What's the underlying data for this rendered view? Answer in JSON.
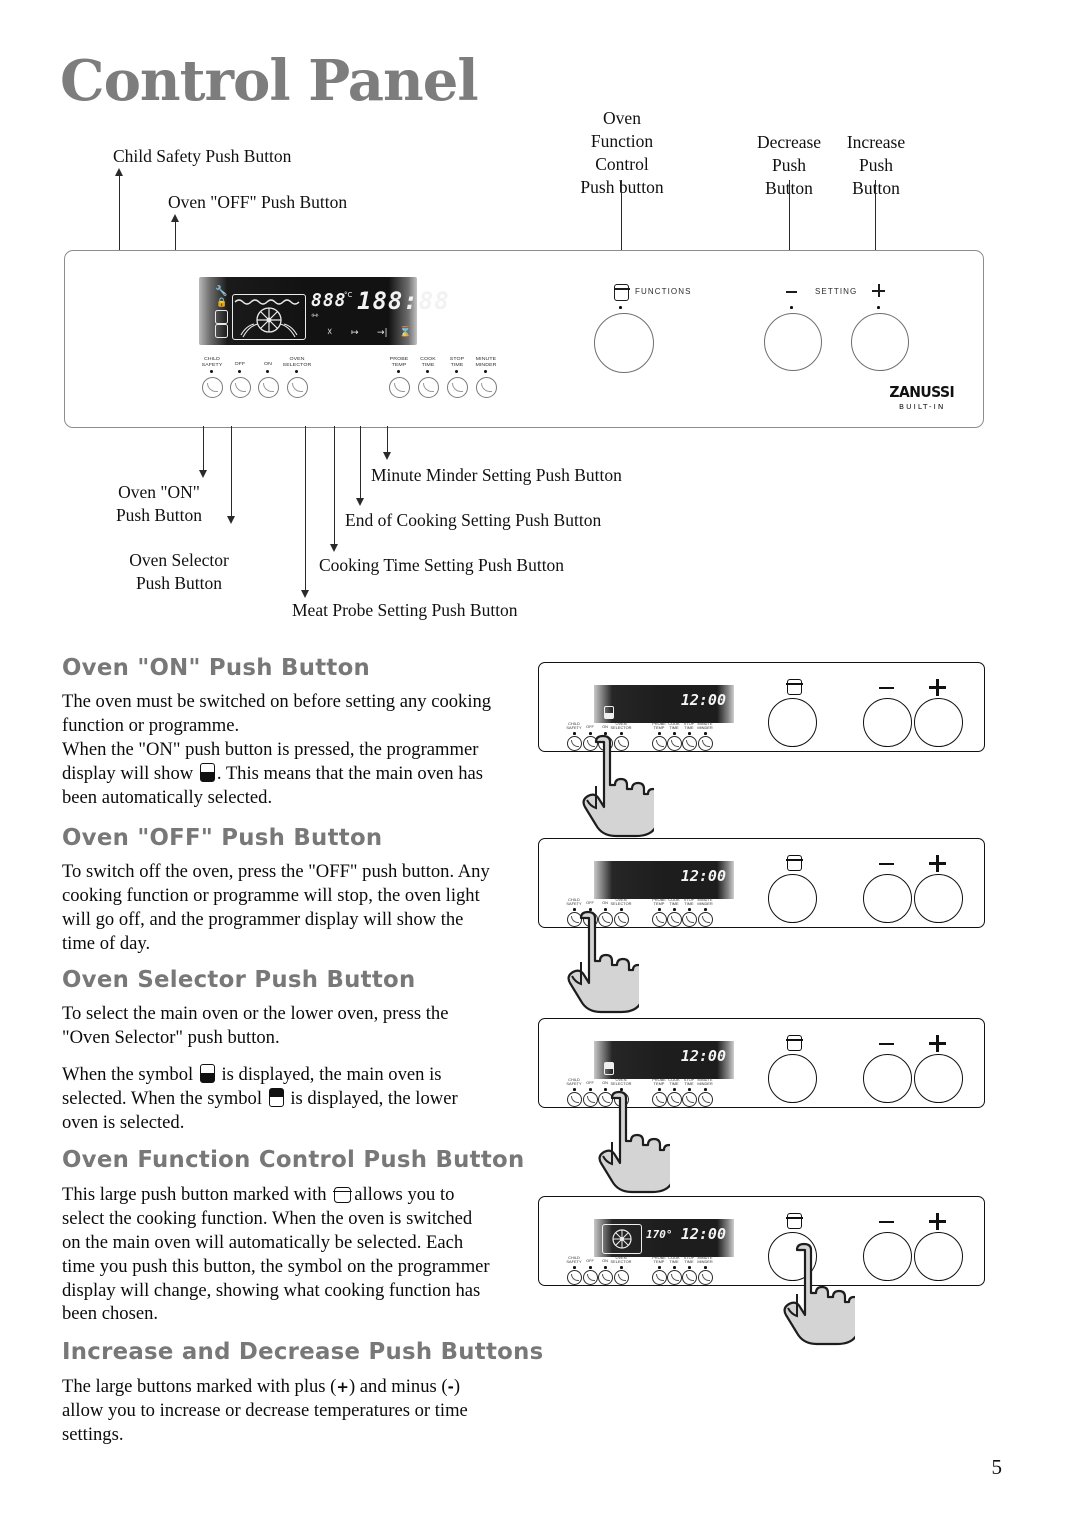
{
  "title": "Control Panel",
  "page_number": "5",
  "diagram": {
    "callouts_top": [
      {
        "text": "Child Safety Push Button"
      },
      {
        "text": "Oven \"OFF\" Push Button"
      },
      {
        "text": "Oven\nFunction\nControl\nPush button"
      },
      {
        "text": "Decrease\nPush\nButton"
      },
      {
        "text": "Increase\nPush\nButton"
      }
    ],
    "callouts_bottom": [
      {
        "text": "Oven \"ON\"\nPush Button"
      },
      {
        "text": "Oven Selector\nPush Button"
      },
      {
        "text": "Minute Minder Setting Push Button"
      },
      {
        "text": "End of Cooking Setting Push Button"
      },
      {
        "text": "Cooking Time Setting Push Button"
      },
      {
        "text": "Meat Probe Setting Push Button"
      }
    ],
    "panel": {
      "left_buttons": [
        {
          "label": "CHILD\nSAFETY"
        },
        {
          "label": "OFF"
        },
        {
          "label": "ON"
        },
        {
          "label": "OVEN\nSELECTOR"
        }
      ],
      "right_buttons": [
        {
          "label": "PROBE\nTEMP"
        },
        {
          "label": "COOK\nTIME"
        },
        {
          "label": "STOP\nTIME"
        },
        {
          "label": "MINUTE\nMINDER"
        }
      ],
      "knob_labels": {
        "functions": "FUNCTIONS",
        "setting": "SETTING"
      },
      "display": {
        "temperature": "888",
        "temp_unit": "°C",
        "clock": "188:88"
      },
      "brand": {
        "name": "ZANUSSI",
        "sub": "BUILT-IN"
      }
    }
  },
  "sections": [
    {
      "heading": "Oven \"ON\" Push Button",
      "p1": "The oven must be switched on before setting any cooking function or programme.",
      "p2_a": "When the \"ON\" push button is pressed, the programmer display will show",
      "p2_b": ". This means that the main oven has been automatically selected."
    },
    {
      "heading": "Oven \"OFF\" Push Button",
      "p1": "To switch off the oven, press the \"OFF\" push button. Any cooking function or programme will stop, the oven light will go off, and the programmer display will show the time of day."
    },
    {
      "heading": "Oven Selector Push Button",
      "p1": "To select the main oven or the lower oven, press the \"Oven Selector\" push button.",
      "p2_a": "When the symbol",
      "p2_b": "is displayed, the main oven is selected. When the symbol",
      "p2_c": "is displayed, the lower oven is selected."
    },
    {
      "heading": "Oven Function Control Push Button",
      "p1_a": "This large push button marked with",
      "p1_b": "allows you to select the cooking function. When the oven is switched on the main oven will automatically be selected. Each time you push this button, the symbol on the programmer display will change, showing what cooking function has been chosen."
    },
    {
      "heading": "Increase and Decrease Push Buttons",
      "p1_a": "The large buttons marked with plus (",
      "p1_plus": "+",
      "p1_b": ") and minus (",
      "p1_minus": "-",
      "p1_c": ") allow you to increase or decrease temperatures or time settings."
    }
  ],
  "illustrations": [
    {
      "name": "oven-on",
      "clock": "12:00",
      "oven_symbol": "main",
      "pressed": "ON",
      "left_labels": [
        "CHILD\nSAFETY",
        "OFF",
        "ON",
        "OVEN\nSELECTOR"
      ],
      "right_labels": [
        "PROBE\nTEMP",
        "COOK\nTIME",
        "STOP\nTIME",
        "MINUTE\nMINDER"
      ]
    },
    {
      "name": "oven-off",
      "clock": "12:00",
      "oven_symbol": "none",
      "pressed": "OFF",
      "left_labels": [
        "CHILD\nSAFETY",
        "OFF",
        "ON",
        "OVEN\nSELECTOR"
      ],
      "right_labels": [
        "PROBE\nTEMP",
        "COOK\nTIME",
        "STOP\nTIME",
        "MINUTE\nMINDER"
      ]
    },
    {
      "name": "oven-selector",
      "clock": "12:00",
      "oven_symbol": "lower",
      "pressed": "OVEN SELECTOR",
      "left_labels": [
        "CHILD\nSAFETY",
        "OFF",
        "ON",
        "OVEN\nSELECTOR"
      ],
      "right_labels": [
        "PROBE\nTEMP",
        "COOK\nTIME",
        "STOP\nTIME",
        "MINUTE\nMINDER"
      ]
    },
    {
      "name": "oven-function-control",
      "clock": "12:00",
      "temperature": "170°",
      "oven_symbol": "fan",
      "pressed": "FUNCTIONS",
      "left_labels": [
        "CHILD\nSAFETY",
        "OFF",
        "ON",
        "OVEN\nSELECTOR"
      ],
      "right_labels": [
        "PROBE\nTEMP",
        "COOK\nTIME",
        "STOP\nTIME",
        "MINUTE\nMINDER"
      ]
    }
  ]
}
